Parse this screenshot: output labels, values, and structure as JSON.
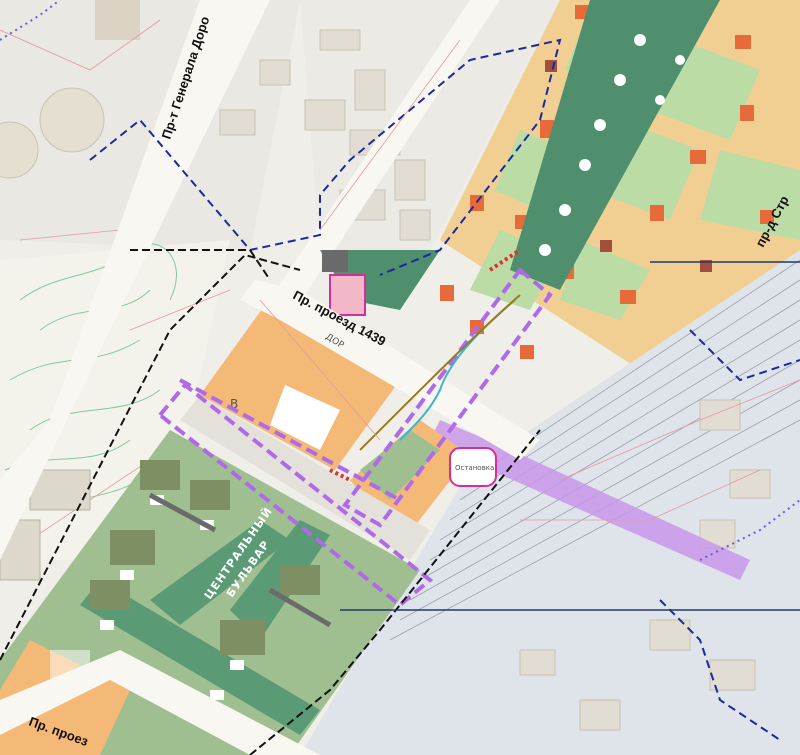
{
  "map": {
    "streets": {
      "general_dorokhov": "Пр-т Генерала Доро",
      "proezd_1439": "Пр. проезд 1439",
      "proezd_bottom": "Пр. проез",
      "proezd_str": "пр-д Стр"
    },
    "boulevard": {
      "line1": "ЦЕНТРАЛЬНЫЙ",
      "line2": "БУЛЬВАР"
    },
    "labels": {
      "dorog": "ДОР",
      "stop": "Остановка",
      "block_code": "В"
    },
    "colors": {
      "residential": "#f4b877",
      "residential_dark": "#e76a3a",
      "park": "#4f8f6e",
      "green": "#b8d7a6",
      "boulevard": "#5a9b76",
      "boundary_purple": "#b06ae8",
      "boundary_blue": "#1a2a9c",
      "highlight": "#d58be8"
    }
  }
}
